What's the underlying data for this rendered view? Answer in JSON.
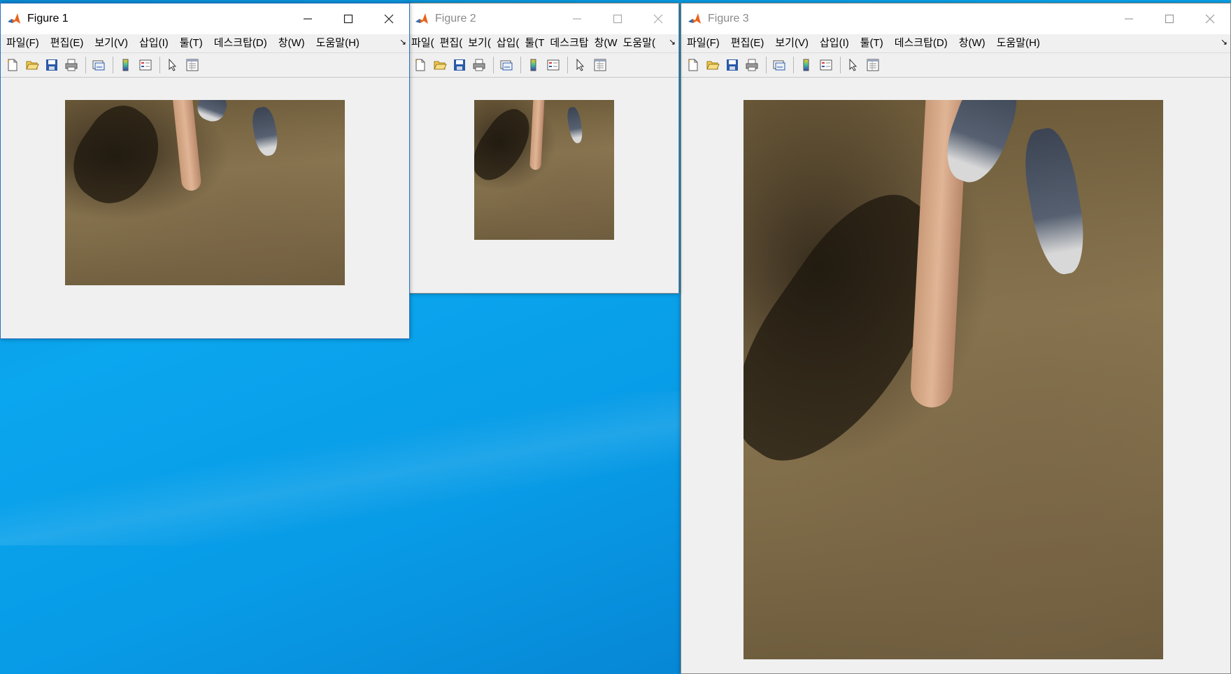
{
  "colors": {
    "desktop": "#0aa6ee",
    "window_bg": "#f0f0f0",
    "active_border": "#2b6fc1",
    "inactive_title": "#8a8a8a",
    "matlab_orange": "#e8641b"
  },
  "figure1": {
    "title": "Figure 1",
    "menu": [
      "파일(F)",
      "편집(E)",
      "보기(V)",
      "삽입(I)",
      "툴(T)",
      "데스크탑(D)",
      "창(W)",
      "도움말(H)"
    ],
    "overflow_icon": "more-menu-icon",
    "image_alt": "photo-pointing-finger"
  },
  "figure2": {
    "title": "Figure 2",
    "menu": [
      "파일(",
      "편집(",
      "보기(",
      "삽입(",
      "툴(T",
      "데스크탑",
      "창(W",
      "도움말("
    ],
    "overflow_icon": "more-menu-icon",
    "image_alt": "photo-pointing-finger"
  },
  "figure3": {
    "title": "Figure 3",
    "menu": [
      "파일(F)",
      "편집(E)",
      "보기(V)",
      "삽입(I)",
      "툴(T)",
      "데스크탑(D)",
      "창(W)",
      "도움말(H)"
    ],
    "overflow_icon": "more-menu-icon",
    "image_alt": "photo-pointing-finger"
  },
  "toolbar_icons": [
    "new-figure-icon",
    "open-file-icon",
    "save-icon",
    "print-icon",
    "link-plot-icon",
    "insert-colorbar-icon",
    "insert-legend-icon",
    "edit-plot-icon",
    "property-inspector-icon"
  ],
  "window_controls": [
    "minimize-icon",
    "maximize-icon",
    "close-icon"
  ]
}
